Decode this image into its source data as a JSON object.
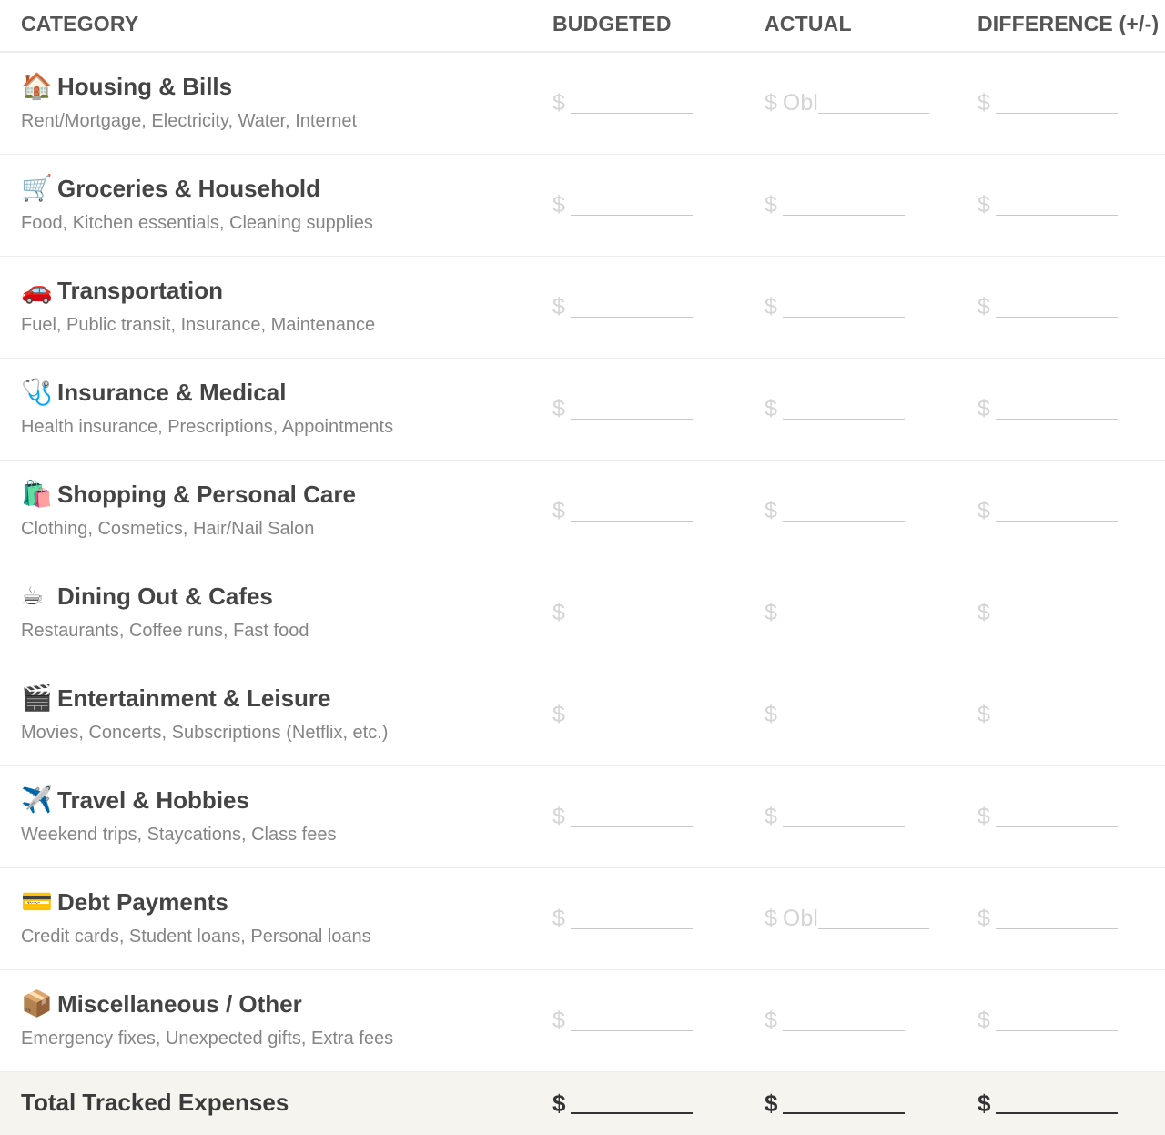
{
  "header": {
    "category": "CATEGORY",
    "budgeted": "BUDGETED",
    "actual": "ACTUAL",
    "difference": "DIFFERENCE (+/-)"
  },
  "currency_symbol": "$",
  "rows": [
    {
      "icon": "🏠",
      "icon_name": "house-icon",
      "name": "Housing & Bills",
      "desc": "Rent/Mortgage, Electricity, Water, Internet",
      "actual_prefill": "Obl"
    },
    {
      "icon": "🛒",
      "icon_name": "shopping-cart-icon",
      "name": "Groceries & Household",
      "desc": "Food, Kitchen essentials, Cleaning supplies",
      "actual_prefill": ""
    },
    {
      "icon": "🚗",
      "icon_name": "car-icon",
      "name": "Transportation",
      "desc": "Fuel, Public transit, Insurance, Maintenance",
      "actual_prefill": ""
    },
    {
      "icon": "🩺",
      "icon_name": "stethoscope-icon",
      "name": "Insurance & Medical",
      "desc": "Health insurance, Prescriptions, Appointments",
      "actual_prefill": ""
    },
    {
      "icon": "🛍️",
      "icon_name": "shopping-bags-icon",
      "name": "Shopping & Personal Care",
      "desc": "Clothing, Cosmetics, Hair/Nail Salon",
      "actual_prefill": ""
    },
    {
      "icon": "☕",
      "icon_name": "coffee-icon",
      "name": "Dining Out & Cafes",
      "desc": "Restaurants, Coffee runs, Fast food",
      "actual_prefill": ""
    },
    {
      "icon": "🎬",
      "icon_name": "clapperboard-icon",
      "name": "Entertainment & Leisure",
      "desc": "Movies, Concerts, Subscriptions (Netflix, etc.)",
      "actual_prefill": ""
    },
    {
      "icon": "✈️",
      "icon_name": "airplane-icon",
      "name": "Travel & Hobbies",
      "desc": "Weekend trips, Staycations, Class fees",
      "actual_prefill": ""
    },
    {
      "icon": "💳",
      "icon_name": "credit-card-icon",
      "name": "Debt Payments",
      "desc": "Credit cards, Student loans, Personal loans",
      "actual_prefill": "Obl"
    },
    {
      "icon": "📦",
      "icon_name": "package-icon",
      "name": "Miscellaneous / Other",
      "desc": "Emergency fixes, Unexpected gifts, Extra fees",
      "actual_prefill": ""
    }
  ],
  "total": {
    "label": "Total Tracked Expenses"
  },
  "colors": {
    "header_text": "#555555",
    "category_text": "#444444",
    "description_text": "#858585",
    "field_placeholder": "#d4d4d4",
    "total_background": "#f5f4ef"
  }
}
